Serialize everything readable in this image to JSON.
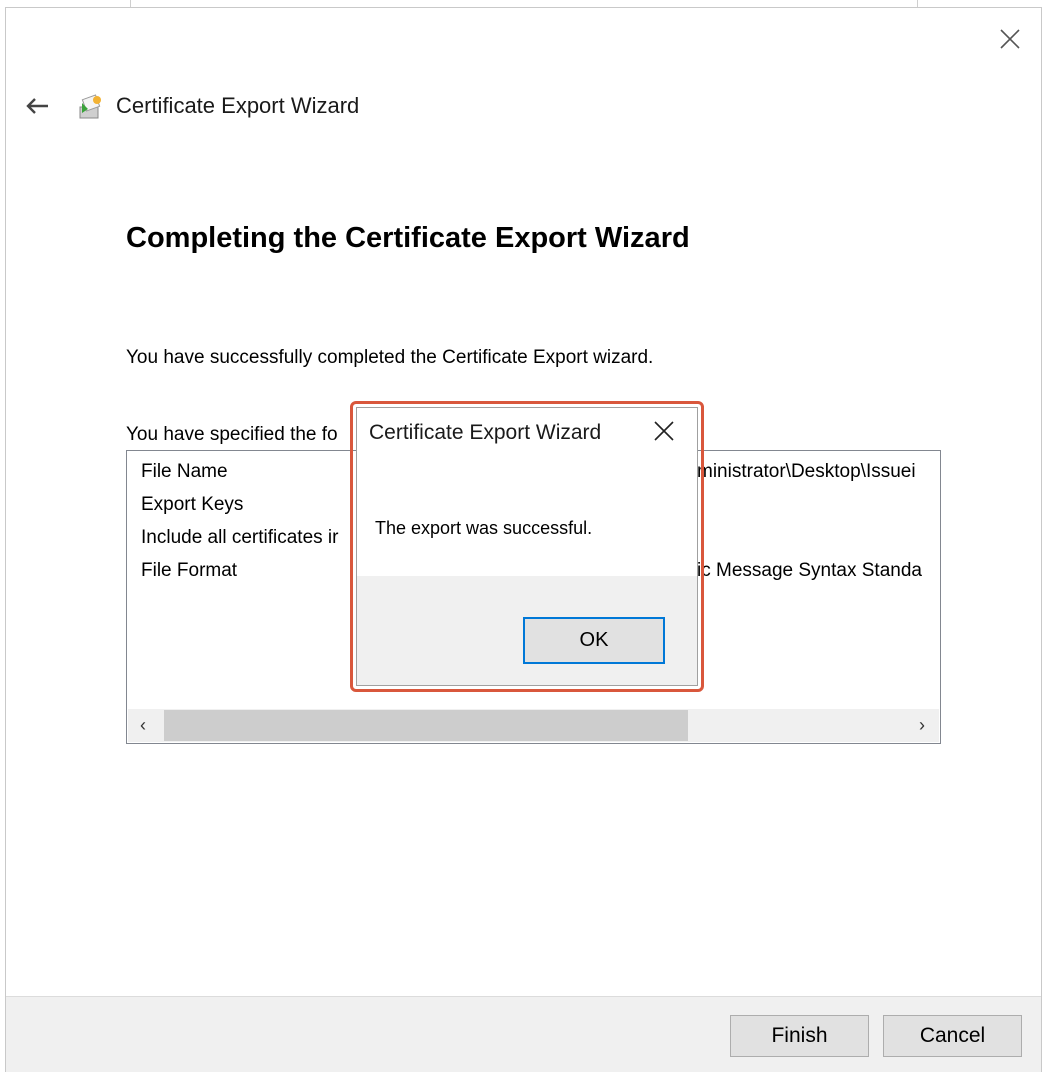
{
  "window": {
    "title": "Certificate Export Wizard"
  },
  "main": {
    "heading": "Completing the Certificate Export Wizard",
    "success_text": "You have successfully completed the Certificate Export wizard.",
    "specified_text": "You have specified the fo",
    "rows": [
      {
        "label": "File Name",
        "value": "ministrator\\Desktop\\Issuei"
      },
      {
        "label": "Export Keys",
        "value": ""
      },
      {
        "label": "Include all certificates ir",
        "value": ""
      },
      {
        "label": "File Format",
        "value": "ic Message Syntax Standa"
      }
    ],
    "scroll_left": "‹",
    "scroll_right": "›"
  },
  "footer": {
    "finish_label": "Finish",
    "cancel_label": "Cancel"
  },
  "popup": {
    "title": "Certificate Export Wizard",
    "message": "The export was successful.",
    "ok_label": "OK"
  },
  "colors": {
    "highlight_outline": "#d9573c",
    "focus_border": "#0078d7"
  },
  "icons": [
    "close-icon",
    "back-arrow-icon",
    "certificate-wizard-icon",
    "scroll-left-icon",
    "scroll-right-icon"
  ]
}
